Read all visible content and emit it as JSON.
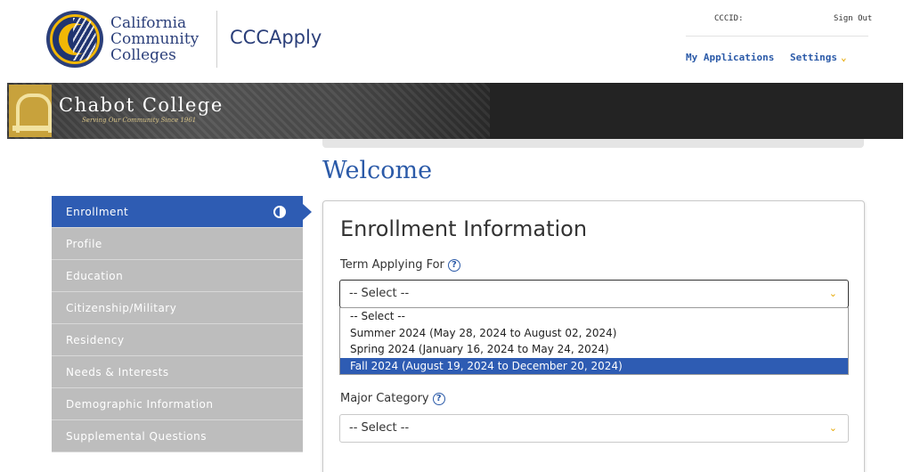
{
  "header": {
    "brand_line1": "California",
    "brand_line2": "Community",
    "brand_line3": "Colleges",
    "app_name": "CCCApply",
    "cccid_label": "CCCID:",
    "sign_out": "Sign Out",
    "nav_my_applications": "My Applications",
    "nav_settings": "Settings"
  },
  "banner": {
    "college_name": "Chabot College",
    "tagline": "Serving Our Community Since 1961"
  },
  "page": {
    "welcome": "Welcome"
  },
  "sidebar": {
    "items": [
      {
        "label": "Enrollment",
        "active": true
      },
      {
        "label": "Profile"
      },
      {
        "label": "Education"
      },
      {
        "label": "Citizenship/Military"
      },
      {
        "label": "Residency"
      },
      {
        "label": "Needs & Interests"
      },
      {
        "label": "Demographic Information"
      },
      {
        "label": "Supplemental Questions"
      }
    ]
  },
  "enrollment": {
    "title": "Enrollment Information",
    "term_label": "Term Applying For",
    "term_selected": "-- Select --",
    "term_options": [
      "-- Select --",
      "Summer 2024 (May 28, 2024 to August 02, 2024)",
      "Spring 2024 (January 16, 2024 to May 24, 2024)",
      "Fall 2024 (August 19, 2024 to December 20, 2024)"
    ],
    "highlighted_option_index": 3,
    "major_label": "Major Category",
    "major_selected": "-- Select --"
  },
  "colors": {
    "primary_blue": "#2e5cb3",
    "link_blue": "#2b5aa8",
    "accent_gold": "#e6a700",
    "sidebar_gray": "#bdbdbd"
  },
  "icons": {
    "help": "question-circle-icon",
    "chevron": "chevron-down-icon",
    "progress": "half-circle-icon"
  }
}
